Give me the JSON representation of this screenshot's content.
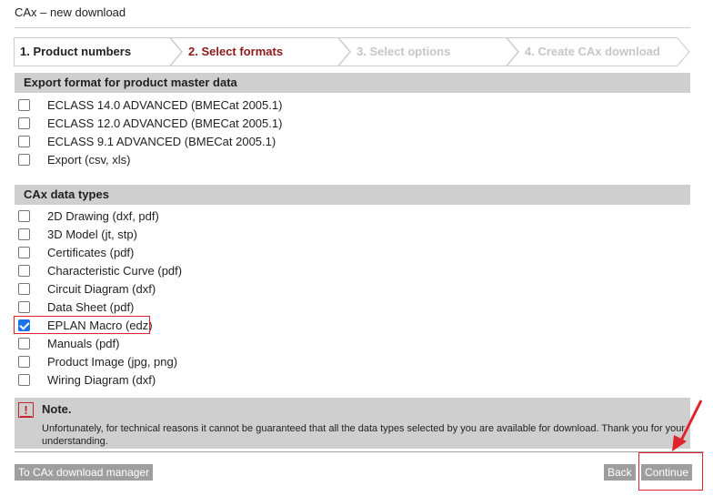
{
  "window": {
    "title": "CAx – new download"
  },
  "stepper": {
    "steps": [
      {
        "label": "1. Product numbers",
        "state": "done"
      },
      {
        "label": "2. Select formats",
        "state": "active"
      },
      {
        "label": "3. Select options",
        "state": "disabled"
      },
      {
        "label": "4. Create CAx download",
        "state": "disabled"
      }
    ]
  },
  "export_section": {
    "heading": "Export format for product master data",
    "options": [
      {
        "label": "ECLASS 14.0 ADVANCED (BMECat 2005.1)",
        "checked": false
      },
      {
        "label": "ECLASS 12.0 ADVANCED (BMECat 2005.1)",
        "checked": false
      },
      {
        "label": "ECLASS 9.1 ADVANCED (BMECat 2005.1)",
        "checked": false
      },
      {
        "label": "Export (csv, xls)",
        "checked": false
      }
    ]
  },
  "cax_section": {
    "heading": "CAx data types",
    "options": [
      {
        "label": "2D Drawing (dxf, pdf)",
        "checked": false
      },
      {
        "label": "3D Model (jt, stp)",
        "checked": false
      },
      {
        "label": "Certificates (pdf)",
        "checked": false
      },
      {
        "label": "Characteristic Curve (pdf)",
        "checked": false
      },
      {
        "label": "Circuit Diagram (dxf)",
        "checked": false
      },
      {
        "label": "Data Sheet (pdf)",
        "checked": false
      },
      {
        "label": "EPLAN Macro (edz)",
        "checked": true
      },
      {
        "label": "Manuals (pdf)",
        "checked": false
      },
      {
        "label": "Product Image (jpg, png)",
        "checked": false
      },
      {
        "label": "Wiring Diagram (dxf)",
        "checked": false
      }
    ]
  },
  "note": {
    "icon": "exclamation-icon",
    "title": "Note.",
    "text": "Unfortunately, for technical reasons it cannot be guaranteed that all the data types selected by you are available for download. Thank you for your understanding."
  },
  "buttons": {
    "manager": "To CAx download manager",
    "back": "Back",
    "continue": "Continue"
  },
  "colors": {
    "active_step": "#8b1a1a",
    "disabled_step": "#c6c6c6",
    "section_bg": "#cfcfcf",
    "button_bg": "#9e9e9e",
    "highlight": "#e0232c",
    "checkbox_checked": "#1a73e8"
  }
}
